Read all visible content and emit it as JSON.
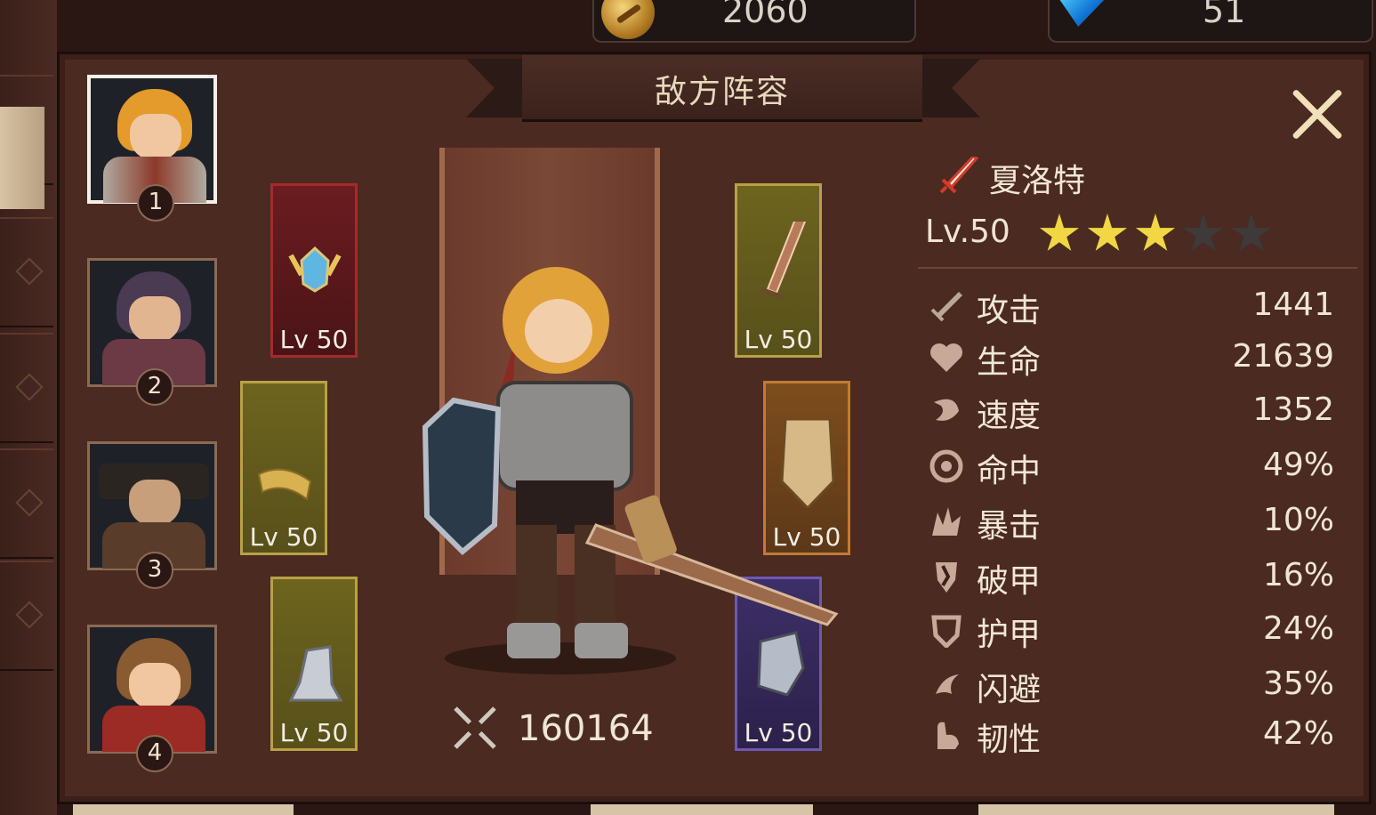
{
  "topbar": {
    "coins": "2060",
    "gems": "51"
  },
  "panel": {
    "title": "敌方阵容"
  },
  "team": [
    {
      "slot": "1",
      "selected": true
    },
    {
      "slot": "2",
      "selected": false
    },
    {
      "slot": "3",
      "selected": false
    },
    {
      "slot": "4",
      "selected": false
    }
  ],
  "equipment": {
    "helmet": {
      "level": "Lv 50",
      "rarity": "red",
      "icon": "helmet-icon"
    },
    "belt": {
      "level": "Lv 50",
      "rarity": "gold",
      "icon": "belt-icon"
    },
    "boots": {
      "level": "Lv 50",
      "rarity": "gold",
      "icon": "boots-icon"
    },
    "sword": {
      "level": "Lv 50",
      "rarity": "gold",
      "icon": "sword-icon"
    },
    "armor": {
      "level": "Lv 50",
      "rarity": "bronze",
      "icon": "armor-icon"
    },
    "gauntlet": {
      "level": "Lv 50",
      "rarity": "purple",
      "icon": "gauntlet-icon"
    }
  },
  "hero": {
    "name": "夏洛特",
    "level": "Lv.50",
    "stars_filled": 3,
    "stars_total": 5,
    "power": "160164"
  },
  "stats": [
    {
      "label": "攻击",
      "value": "1441",
      "icon": "attack-icon"
    },
    {
      "label": "生命",
      "value": "21639",
      "icon": "heart-icon"
    },
    {
      "label": "速度",
      "value": "1352",
      "icon": "speed-icon"
    },
    {
      "label": "命中",
      "value": "49%",
      "icon": "accuracy-icon"
    },
    {
      "label": "暴击",
      "value": "10%",
      "icon": "critical-icon"
    },
    {
      "label": "破甲",
      "value": "16%",
      "icon": "armor-break-icon"
    },
    {
      "label": "护甲",
      "value": "24%",
      "icon": "shield-icon"
    },
    {
      "label": "闪避",
      "value": "35%",
      "icon": "dodge-icon"
    },
    {
      "label": "韧性",
      "value": "42%",
      "icon": "toughness-icon"
    }
  ],
  "colors": {
    "star_on": "#f0d743",
    "star_off": "#3d3a39",
    "panel": "#4a2a21"
  }
}
